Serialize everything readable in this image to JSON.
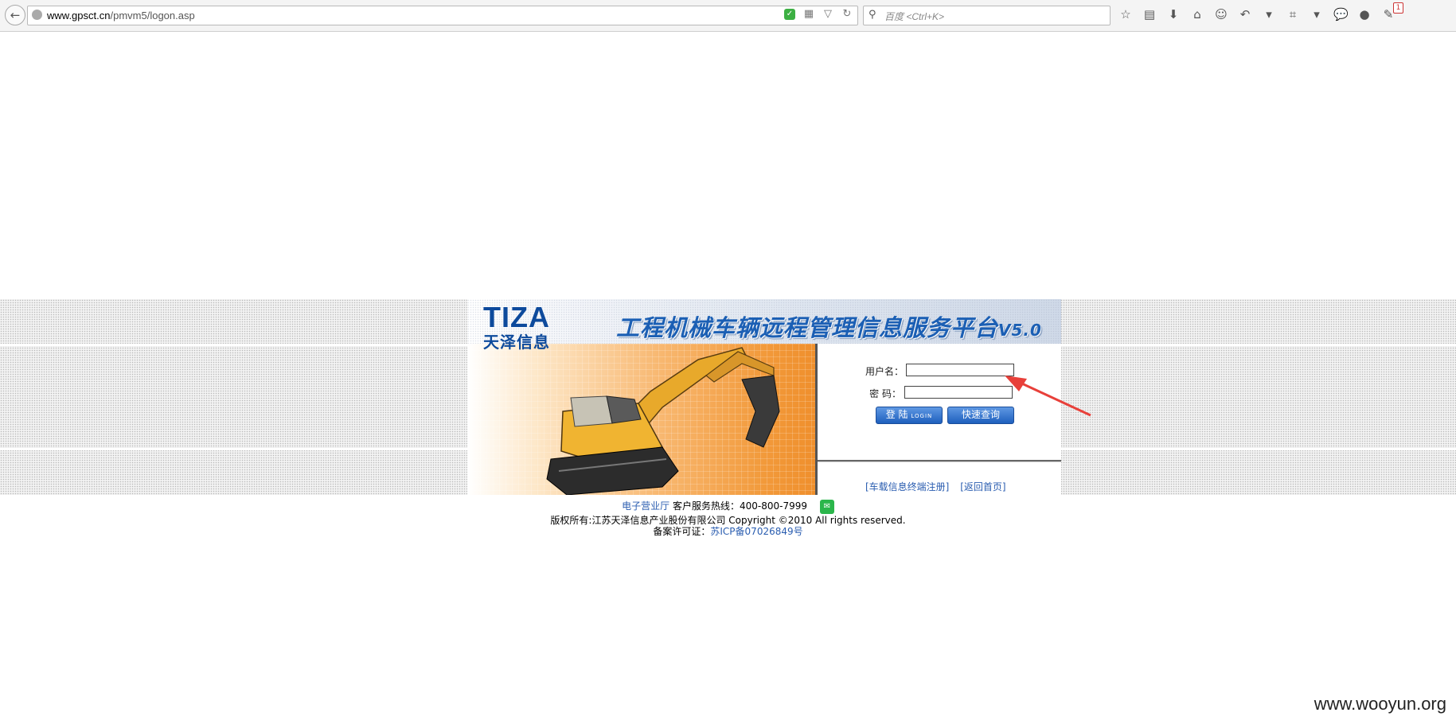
{
  "browser": {
    "url_host": "www.gpsct.cn",
    "url_path": "/pmvm5/logon.asp",
    "search_placeholder": "百度 <Ctrl+K>",
    "notification_count": "1"
  },
  "login": {
    "logo_en": "TIZA",
    "logo_cn": "天泽信息",
    "title": "工程机械车辆远程管理信息服务平台",
    "version": "V5.0",
    "username_label": "用户名：",
    "password_label": "密  码：",
    "username_value": "",
    "password_value": "",
    "login_button": "登 陆",
    "login_button_sub": "LOGIN",
    "query_button": "快速查询",
    "link_register": "[车载信息终端注册]",
    "link_home": "[返回首页]"
  },
  "footer": {
    "service_hall": "电子营业厅",
    "hotline": "客户服务热线：400-800-7999",
    "copyright": "版权所有:江苏天泽信息产业股份有限公司 Copyright ©2010 All rights reserved.",
    "icp_label": "备案许可证：",
    "icp_number": "苏ICP备07026849号"
  },
  "watermark": "www.wooyun.org"
}
